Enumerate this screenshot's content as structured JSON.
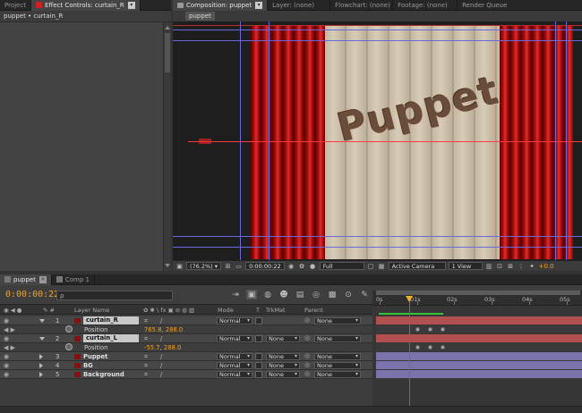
{
  "top_tabs": {
    "project": "Project",
    "effect_controls": "Effect Controls: curtain_R",
    "composition": "Composition: puppet",
    "layer": "Layer: (none)",
    "flowchart": "Flowchart: (none)",
    "footage": "Footage: (none)",
    "render_queue": "Render Queue"
  },
  "effect_controls": {
    "breadcrumb": "puppet • curtain_R"
  },
  "viewer": {
    "comp_chip": "puppet",
    "stage_text": "Puppet",
    "zoom": "(76.2%)",
    "timecode": "0:00:00:22",
    "resolution": "Full",
    "camera": "Active Camera",
    "views": "1 View",
    "exposure": "+0.0"
  },
  "timeline": {
    "tabs": [
      "puppet",
      "Comp 1"
    ],
    "timecode": "0:00:00:22",
    "search_placeholder": "ρ",
    "columns": {
      "layer_name": "Layer Name",
      "mode": "Mode",
      "t": "T",
      "trkmat": "TrkMat",
      "parent": "Parent"
    },
    "ruler_ticks": [
      "0s",
      "01s",
      "02s",
      "03s",
      "04s",
      "05s"
    ],
    "layers": [
      {
        "num": "1",
        "name": "curtain_R",
        "selected": true,
        "open": true,
        "mode": "Normal",
        "trkmat": "",
        "parent": "None",
        "prop": "Position",
        "value": "765.8, 288.0"
      },
      {
        "num": "2",
        "name": "curtain_L",
        "selected": true,
        "open": true,
        "mode": "Normal",
        "trkmat": "None",
        "parent": "None",
        "prop": "Position",
        "value": "-55.7, 288.0"
      },
      {
        "num": "3",
        "name": "Puppet",
        "selected": false,
        "open": false,
        "mode": "Normal",
        "trkmat": "None",
        "parent": "None"
      },
      {
        "num": "4",
        "name": "BG",
        "selected": false,
        "open": false,
        "mode": "Normal",
        "trkmat": "None",
        "parent": "None"
      },
      {
        "num": "5",
        "name": "Background",
        "selected": false,
        "open": false,
        "mode": "Normal",
        "trkmat": "None",
        "parent": "None"
      }
    ]
  },
  "colors": {
    "accent_orange": "#f0a020",
    "curtain_red": "#b01010",
    "purple_bar": "#7a74ad"
  }
}
